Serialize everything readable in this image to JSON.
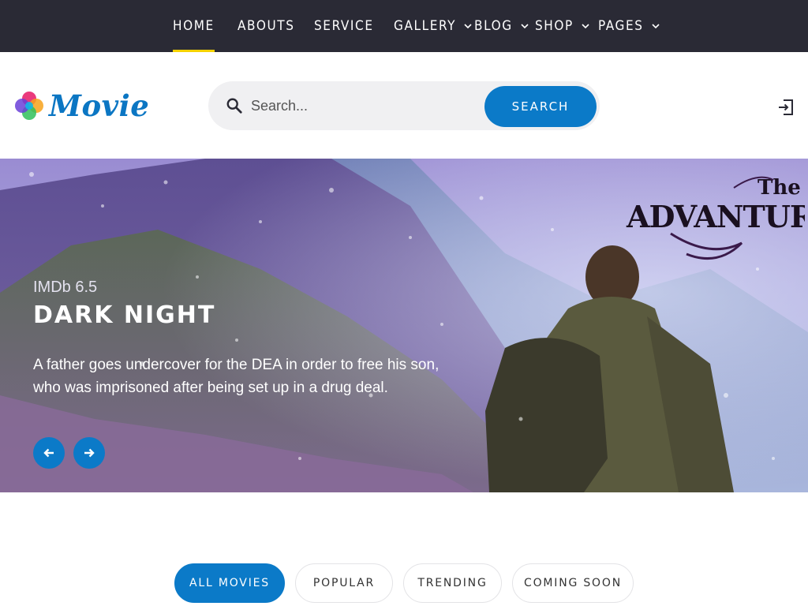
{
  "nav": {
    "items": [
      {
        "label": "HOME",
        "active": true,
        "dropdown": false
      },
      {
        "label": "ABOUTS",
        "active": false,
        "dropdown": false
      },
      {
        "label": "SERVICE",
        "active": false,
        "dropdown": false
      },
      {
        "label": "GALLERY",
        "active": false,
        "dropdown": true
      },
      {
        "label": "BLOG",
        "active": false,
        "dropdown": true
      },
      {
        "label": "SHOP",
        "active": false,
        "dropdown": true
      },
      {
        "label": "PAGES",
        "active": false,
        "dropdown": true
      }
    ]
  },
  "header": {
    "logo_text": "Movie",
    "search_placeholder": "Search...",
    "search_button": "SEARCH",
    "login_icon": "login-icon"
  },
  "hero": {
    "rating": "IMDb 6.5",
    "title": "DARK NIGHT",
    "description": "A father goes undercover for the DEA in order to free his son, who was imprisoned after being set up in a drug deal.",
    "poster_title_small": "The",
    "poster_title_large": "ADVANTURE",
    "prev_icon": "arrow-left-icon",
    "next_icon": "arrow-right-icon"
  },
  "filters": {
    "items": [
      {
        "label": "ALL MOVIES",
        "active": true
      },
      {
        "label": "POPULAR",
        "active": false
      },
      {
        "label": "TRENDING",
        "active": false
      },
      {
        "label": "COMING SOON",
        "active": false
      }
    ]
  },
  "colors": {
    "accent": "#0b7ac8",
    "nav_bg": "#2a2a35",
    "active_underline": "#f5d200"
  }
}
